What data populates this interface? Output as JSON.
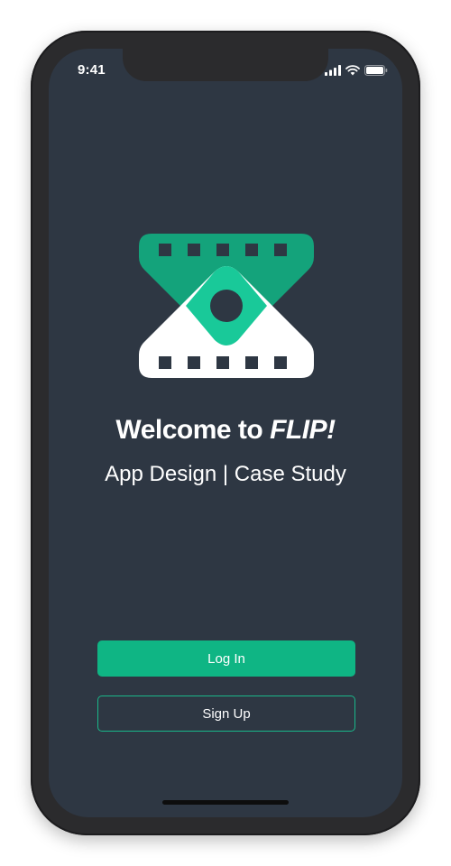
{
  "status_bar": {
    "time": "9:41",
    "icons": [
      "signal-icon",
      "wifi-icon",
      "battery-icon"
    ]
  },
  "logo": {
    "icon": "film-reel-logo-icon",
    "colors": {
      "green_dark": "#14a37b",
      "green_light": "#19c999",
      "white": "#ffffff"
    }
  },
  "welcome": {
    "prefix": "Welcome to ",
    "brand": "FLIP!"
  },
  "subtitle": "App Design | Case Study",
  "buttons": {
    "login_label": "Log In",
    "signup_label": "Sign Up"
  },
  "colors": {
    "background": "#2e3743",
    "accent": "#0fb584",
    "text": "#ffffff"
  }
}
